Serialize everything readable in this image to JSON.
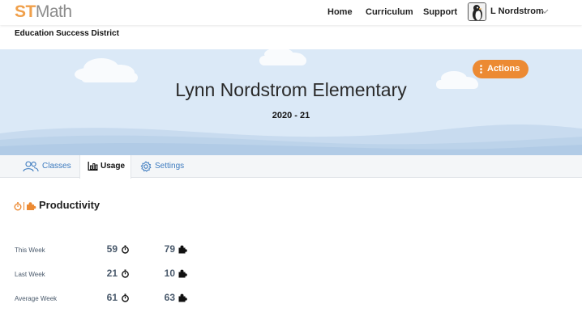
{
  "logo": {
    "part1": "ST",
    "part2": "Math"
  },
  "nav": {
    "home": "Home",
    "curriculum": "Curriculum",
    "support": "Support"
  },
  "user": {
    "name": "L Nordstrom"
  },
  "district": "Education Success District",
  "banner": {
    "title": "Lynn Nordstrom Elementary",
    "year": "2020 - 21",
    "actions_label": "Actions"
  },
  "tabs": [
    {
      "label": "Classes",
      "icon": "people-icon",
      "active": false
    },
    {
      "label": "Usage",
      "icon": "bar-chart-icon",
      "active": true
    },
    {
      "label": "Settings",
      "icon": "gear-icon",
      "active": false
    }
  ],
  "productivity": {
    "title": "Productivity",
    "rows": [
      {
        "label": "This Week",
        "minutes": "59",
        "puzzles": "79"
      },
      {
        "label": "Last Week",
        "minutes": "21",
        "puzzles": "10"
      },
      {
        "label": "Average Week",
        "minutes": "61",
        "puzzles": "63"
      }
    ]
  },
  "colors": {
    "accent": "#ec8a33",
    "link": "#3d7bbf",
    "banner_sky": "#dbe9f7",
    "logo_orange": "#f0a04b"
  }
}
